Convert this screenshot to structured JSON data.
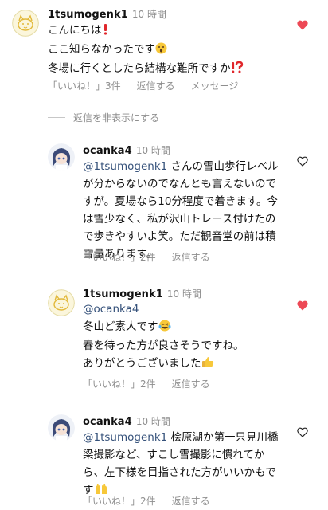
{
  "comments": [
    {
      "user": "1tsumogenk1",
      "time": "10 時間",
      "lines": [
        "こんにちは",
        "ここ知らなかったです",
        "冬場に行くとしたら結構な難所ですか"
      ],
      "likes": "「いいね！」3件",
      "reply": "返信する",
      "message": "メッセージ",
      "liked": true
    },
    {
      "user": "ocanka4",
      "time": "10 時間",
      "mention": "@1tsumogenk1",
      "text": " さんの雪山歩行レベルが分からないのでなんとも言えないのですが。夏場なら10分程度で着きます。今は雪少なく、私が沢山トレース付けたので歩きやすいよ笑。ただ観音堂の前は積雪量あります。",
      "likes": "「いいね！」2件",
      "reply": "返信する",
      "liked": false
    },
    {
      "user": "1tsumogenk1",
      "time": "10 時間",
      "mention": "@ocanka4",
      "lines": [
        "冬山ど素人です",
        "春を待った方が良さそうですね。",
        "ありがとうございました"
      ],
      "likes": "「いいね！」2件",
      "reply": "返信する",
      "liked": true
    },
    {
      "user": "ocanka4",
      "time": "10 時間",
      "mention": "@1tsumogenk1",
      "text": " 桧原湖か第一只見川橋梁撮影など、すこし雪撮影に慣れてから、左下様を目指された方がいいかもです",
      "likes": "「いいね！」2件",
      "reply": "返信する",
      "liked": false
    }
  ],
  "hide_replies_label": "返信を非表示にする",
  "colors": {
    "heart_liked": "#ed4956",
    "mention": "#35517a",
    "meta": "#8e8e8e"
  }
}
